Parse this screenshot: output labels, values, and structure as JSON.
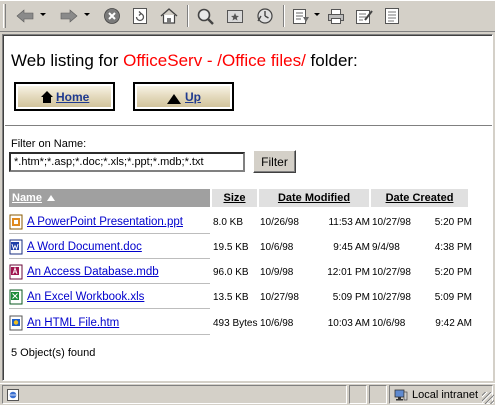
{
  "toolbar": {
    "icons": [
      "back-icon",
      "forward-icon",
      "stop-icon",
      "refresh-icon",
      "home-icon",
      "search-icon",
      "favorites-icon",
      "history-icon",
      "mail-icon",
      "print-icon",
      "edit-icon",
      "discuss-icon"
    ]
  },
  "heading": {
    "prefix": "Web listing for",
    "location": "OfficeServ - /Office files/",
    "suffix": "folder:"
  },
  "nav": {
    "home_label": "Home",
    "up_label": "Up"
  },
  "filter": {
    "label": "Filter on Name:",
    "value": "*.htm*;*.asp;*.doc;*.xls;*.ppt;*.mdb;*.txt",
    "button": "Filter"
  },
  "table": {
    "columns": {
      "name": "Name",
      "size": "Size",
      "modified": "Date Modified",
      "created": "Date Created"
    },
    "rows": [
      {
        "icon": "powerpoint-file-icon",
        "name": "A PowerPoint Presentation.ppt",
        "size": "8.0 KB",
        "mod_date": "10/26/98",
        "mod_time": "11:53 AM",
        "crt_date": "10/27/98",
        "crt_time": "5:20 PM"
      },
      {
        "icon": "word-file-icon",
        "name": "A Word Document.doc",
        "size": "19.5 KB",
        "mod_date": "10/6/98",
        "mod_time": "9:45 AM",
        "crt_date": "9/4/98",
        "crt_time": "4:38 PM"
      },
      {
        "icon": "access-file-icon",
        "name": "An Access Database.mdb",
        "size": "96.0 KB",
        "mod_date": "10/9/98",
        "mod_time": "12:01 PM",
        "crt_date": "10/27/98",
        "crt_time": "5:20 PM"
      },
      {
        "icon": "excel-file-icon",
        "name": "An Excel Workbook.xls",
        "size": "13.5 KB",
        "mod_date": "10/27/98",
        "mod_time": "5:09 PM",
        "crt_date": "10/27/98",
        "crt_time": "5:09 PM"
      },
      {
        "icon": "html-file-icon",
        "name": "An HTML File.htm",
        "size": "493 Bytes",
        "mod_date": "10/6/98",
        "mod_time": "10:03 AM",
        "crt_date": "10/6/98",
        "crt_time": "9:42 AM"
      }
    ]
  },
  "count_text": "5 Object(s) found",
  "status": {
    "zone": "Local intranet"
  },
  "colors": {
    "location_red": "#ff0000",
    "link_blue": "#0000cc",
    "chrome": "#d4d0c8"
  }
}
